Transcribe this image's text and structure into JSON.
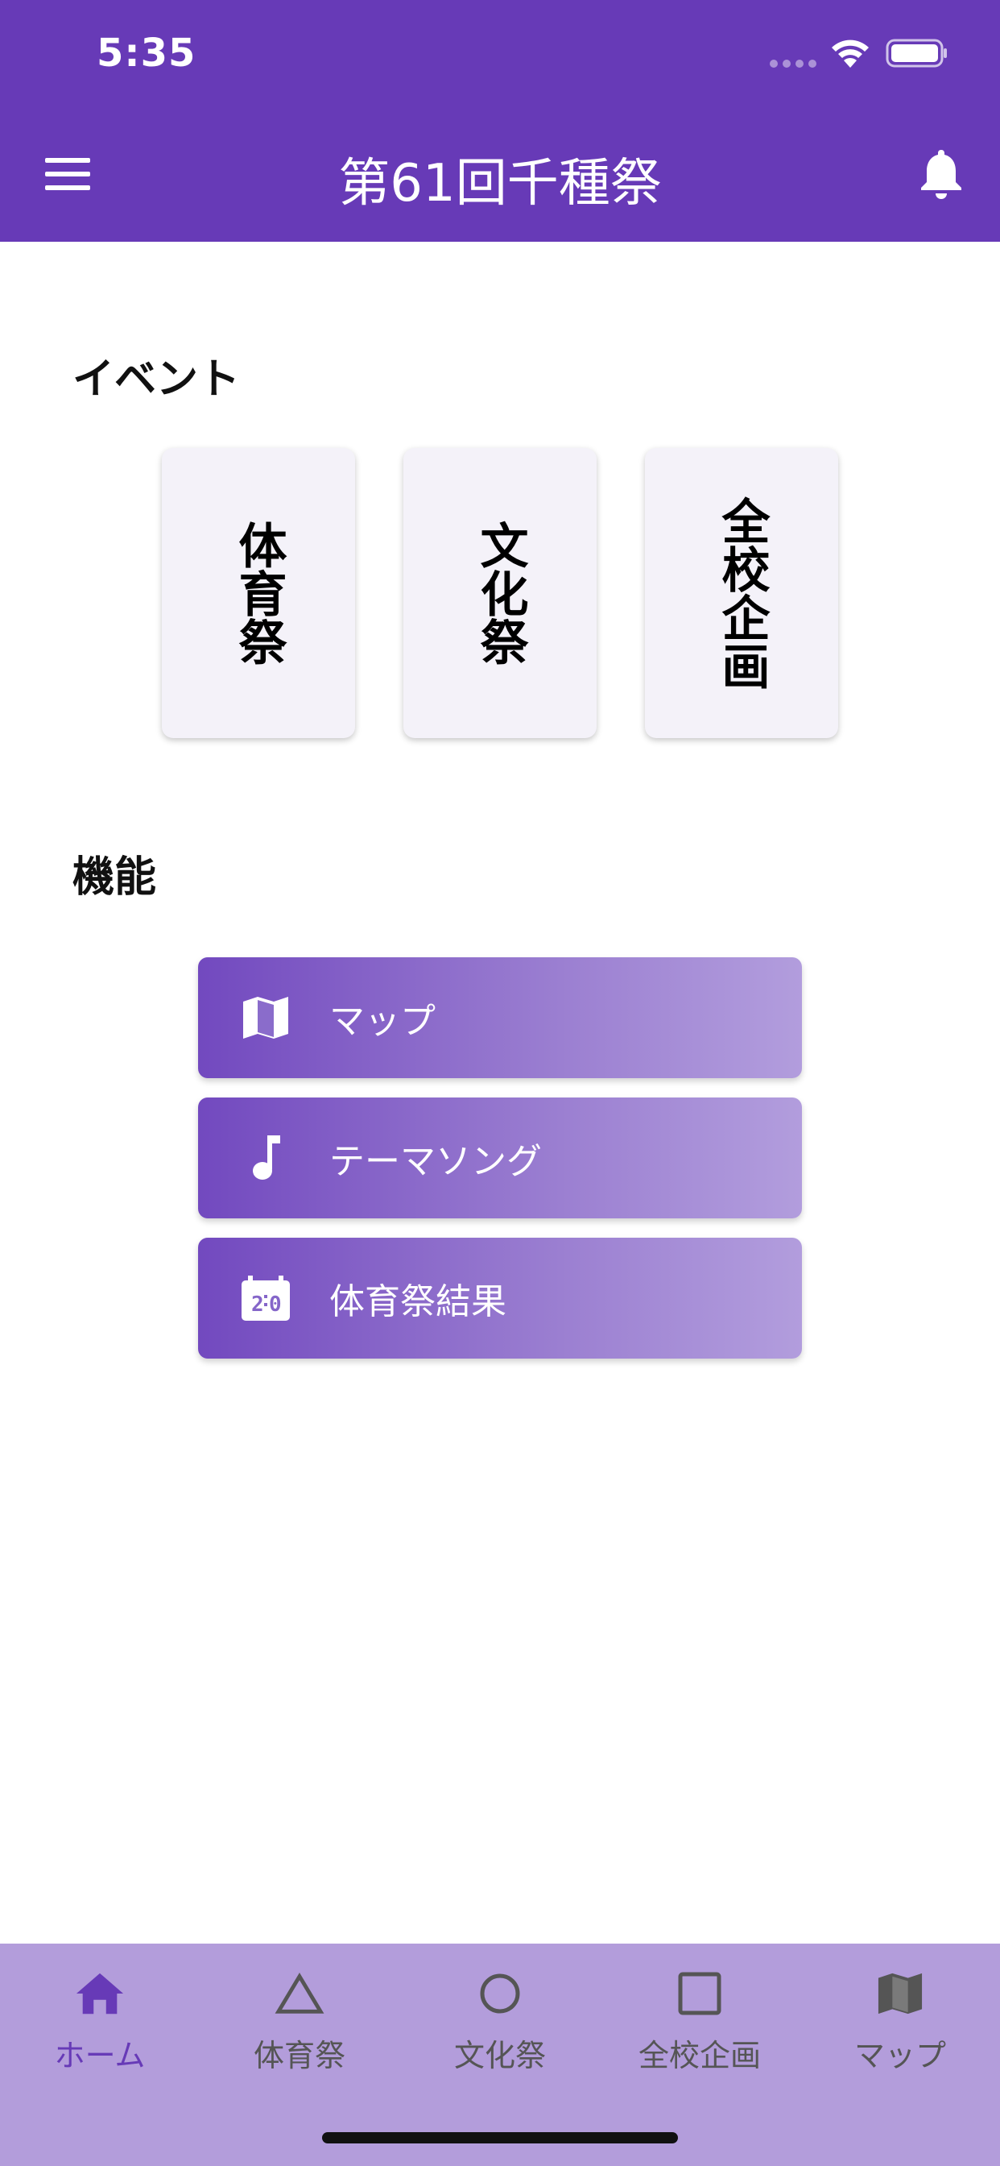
{
  "status_bar": {
    "time": "5:35"
  },
  "app_bar": {
    "title": "第61回千種祭",
    "menu_icon": "menu-icon",
    "bell_icon": "bell-icon"
  },
  "events": {
    "title": "イベント",
    "cards": [
      {
        "label": "体育祭"
      },
      {
        "label": "文化祭"
      },
      {
        "label": "全校企画"
      }
    ]
  },
  "features": {
    "title": "機能",
    "buttons": [
      {
        "label": "マップ",
        "icon": "map-icon"
      },
      {
        "label": "テーマソング",
        "icon": "music-note-icon"
      },
      {
        "label": "体育祭結果",
        "icon": "scoreboard-icon"
      }
    ]
  },
  "bottom_nav": {
    "items": [
      {
        "label": "ホーム",
        "icon": "home-icon",
        "active": true
      },
      {
        "label": "体育祭",
        "icon": "triangle-icon",
        "active": false
      },
      {
        "label": "文化祭",
        "icon": "circle-icon",
        "active": false
      },
      {
        "label": "全校企画",
        "icon": "square-icon",
        "active": false
      },
      {
        "label": "マップ",
        "icon": "map-icon",
        "active": false
      }
    ]
  },
  "colors": {
    "primary": "#673ab7",
    "nav_background": "#b39ddb",
    "card_background": "#f4f2f9"
  }
}
